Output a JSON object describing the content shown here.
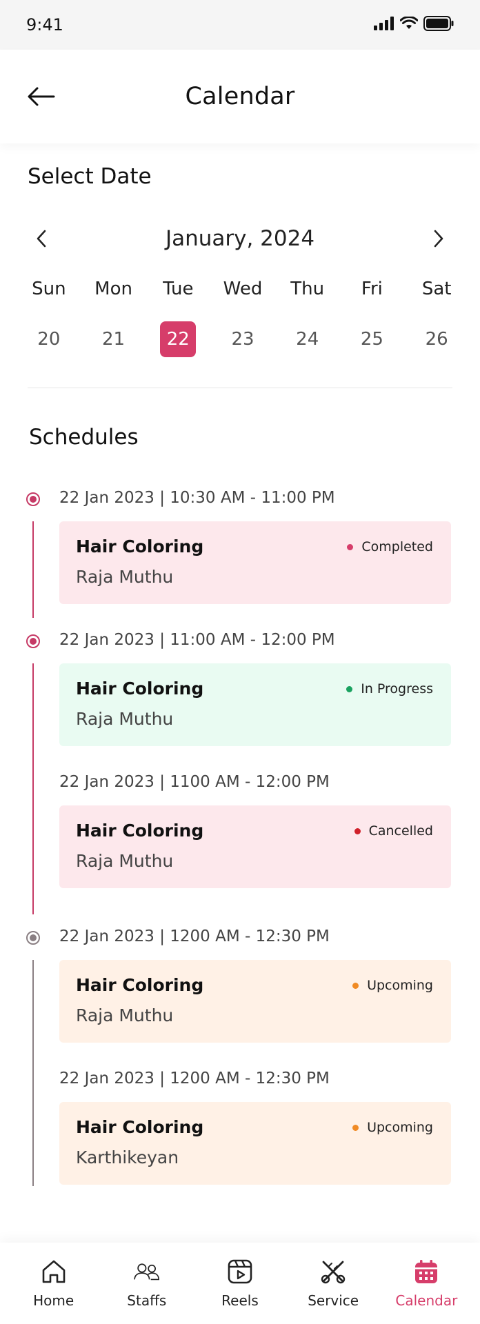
{
  "status_bar": {
    "time": "9:41"
  },
  "header": {
    "title": "Calendar"
  },
  "calendar": {
    "section_title": "Select Date",
    "month_label": "January, 2024",
    "weekdays": [
      "Sun",
      "Mon",
      "Tue",
      "Wed",
      "Thu",
      "Fri",
      "Sat"
    ],
    "dates": [
      "20",
      "21",
      "22",
      "23",
      "24",
      "25",
      "26"
    ],
    "selected_index": 2
  },
  "schedules": {
    "section_title": "Schedules",
    "items": [
      {
        "time": "22 Jan 2023  |  10:30 AM - 11:00 PM",
        "service": "Hair Coloring",
        "person": "Raja Muthu",
        "status": "Completed"
      },
      {
        "time": "22 Jan 2023  |  11:00 AM - 12:00 PM",
        "service": "Hair Coloring",
        "person": "Raja Muthu",
        "status": "In Progress"
      },
      {
        "time": "22 Jan 2023  |  1100 AM - 12:00 PM",
        "service": "Hair Coloring",
        "person": "Raja Muthu",
        "status": "Cancelled"
      },
      {
        "time": "22 Jan 2023  |  1200 AM - 12:30 PM",
        "service": "Hair Coloring",
        "person": "Raja Muthu",
        "status": "Upcoming"
      },
      {
        "time": "22 Jan 2023  |  1200 AM - 12:30 PM",
        "service": "Hair Coloring",
        "person": "Karthikeyan",
        "status": "Upcoming"
      }
    ]
  },
  "bottom_nav": {
    "items": [
      {
        "label": "Home",
        "icon": "home-icon"
      },
      {
        "label": "Staffs",
        "icon": "staffs-icon"
      },
      {
        "label": "Reels",
        "icon": "reels-icon"
      },
      {
        "label": "Service",
        "icon": "service-icon"
      },
      {
        "label": "Calendar",
        "icon": "calendar-icon",
        "active": true
      }
    ]
  },
  "colors": {
    "accent": "#d63d6a",
    "completed_bg": "#fde8ec",
    "completed_dot": "#d63d6a",
    "in_progress_bg": "#e9fbf2",
    "in_progress_dot": "#1aa260",
    "cancelled_bg": "#fde8ec",
    "cancelled_dot": "#d0202a",
    "upcoming_bg": "#fff1e6",
    "upcoming_dot": "#f08a24",
    "past_timeline": "#c63a66",
    "future_timeline": "#8a7f83"
  }
}
